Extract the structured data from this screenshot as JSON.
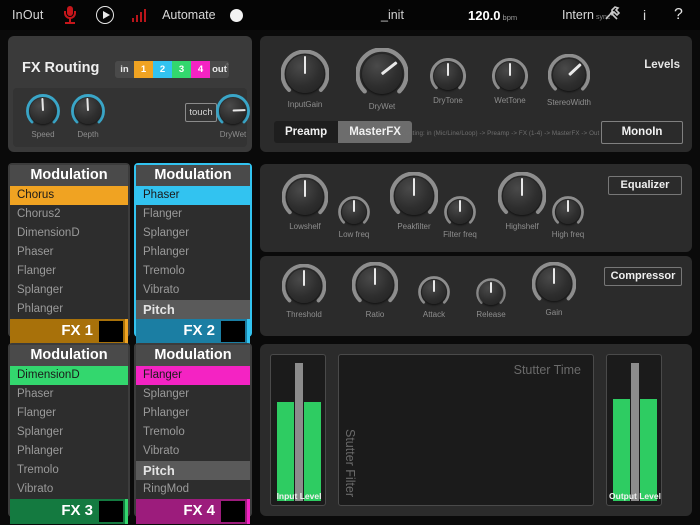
{
  "topbar": {
    "inout": "InOut",
    "mic_icon": "microphone-icon",
    "play_icon": "play-circle-icon",
    "signal_icon": "signal-bars-icon",
    "automate": "Automate",
    "record_icon": "record-dot-icon",
    "preset": "_init",
    "bpm_value": "120.0",
    "bpm_unit": "bpm",
    "sync_mode": "Intern",
    "sync_unit": "sync",
    "tools_icon": "tools-icon",
    "info_label": "i",
    "help_label": "?"
  },
  "fx_routing": {
    "title": "FX Routing",
    "chain_in": "in",
    "chain_out": "out",
    "chain_slots": [
      "1",
      "2",
      "3",
      "4"
    ],
    "arrow_up_icon": "arrow-up-icon",
    "arrow_down_icon": "arrow-down-icon",
    "touch_label": "touch",
    "knobs": [
      {
        "label": "Speed",
        "angle": -3
      },
      {
        "label": "Depth",
        "angle": -3
      },
      {
        "label": "DryWet",
        "angle": 88
      }
    ]
  },
  "levels": {
    "title": "Levels",
    "knobs": [
      {
        "label": "InputGain",
        "angle": 0
      },
      {
        "label": "DryWet",
        "angle": 52
      },
      {
        "label": "DryTone",
        "angle": 0
      },
      {
        "label": "WetTone",
        "angle": 0
      },
      {
        "label": "StereoWidth",
        "angle": 47
      }
    ],
    "segment": [
      {
        "label": "Preamp",
        "active": false
      },
      {
        "label": "MasterFX",
        "active": true
      }
    ],
    "routing_text": "Routing: in (Mic/Line/Loop) -> Preamp -> FX (1-4) -> MasterFX -> Out",
    "mono_label": "MonoIn"
  },
  "equalizer": {
    "title": "Equalizer",
    "knobs": [
      {
        "label": "Lowshelf",
        "angle": 0
      },
      {
        "label": "Low freq",
        "angle": 0
      },
      {
        "label": "Peakfilter",
        "angle": 0
      },
      {
        "label": "Filter freq",
        "angle": 0
      },
      {
        "label": "Highshelf",
        "angle": 0
      },
      {
        "label": "High freq",
        "angle": 0
      }
    ]
  },
  "compressor": {
    "title": "Compressor",
    "knobs": [
      {
        "label": "Threshold",
        "angle": 0
      },
      {
        "label": "Ratio",
        "angle": 0
      },
      {
        "label": "Attack",
        "angle": 0
      },
      {
        "label": "Release",
        "angle": 0
      },
      {
        "label": "Gain",
        "angle": 0
      }
    ]
  },
  "meters": {
    "input_label": "Input Level",
    "output_label": "Output Level",
    "input_level_pct": 72,
    "output_level_pct": 74,
    "xy_x_label": "Stutter Time",
    "xy_y_label": "Stutter Filter"
  },
  "fx_slots": [
    {
      "header": "Modulation",
      "footer": "FX 1",
      "accent": "#f0a322",
      "footer_bg": "#a8710a",
      "selected": "Chorus",
      "items": [
        {
          "label": "Chorus",
          "type": "item",
          "selected": true
        },
        {
          "label": "Chorus2",
          "type": "item",
          "selected": false
        },
        {
          "label": "DimensionD",
          "type": "item",
          "selected": false
        },
        {
          "label": "Phaser",
          "type": "item",
          "selected": false
        },
        {
          "label": "Flanger",
          "type": "item",
          "selected": false
        },
        {
          "label": "Splanger",
          "type": "item",
          "selected": false
        },
        {
          "label": "Phlanger",
          "type": "item",
          "selected": false
        }
      ]
    },
    {
      "header": "Modulation",
      "footer": "FX 2",
      "accent": "#32c3f0",
      "footer_bg": "#1b7ea3",
      "selected": "Phaser",
      "items": [
        {
          "label": "Phaser",
          "type": "item",
          "selected": true
        },
        {
          "label": "Flanger",
          "type": "item",
          "selected": false
        },
        {
          "label": "Splanger",
          "type": "item",
          "selected": false
        },
        {
          "label": "Phlanger",
          "type": "item",
          "selected": false
        },
        {
          "label": "Tremolo",
          "type": "item",
          "selected": false
        },
        {
          "label": "Vibrato",
          "type": "item",
          "selected": false
        },
        {
          "label": "Pitch",
          "type": "category",
          "selected": false
        }
      ]
    },
    {
      "header": "Modulation",
      "footer": "FX 3",
      "accent": "#33d76e",
      "footer_bg": "#147a40",
      "selected": "DimensionD",
      "items": [
        {
          "label": "DimensionD",
          "type": "item",
          "selected": true
        },
        {
          "label": "Phaser",
          "type": "item",
          "selected": false
        },
        {
          "label": "Flanger",
          "type": "item",
          "selected": false
        },
        {
          "label": "Splanger",
          "type": "item",
          "selected": false
        },
        {
          "label": "Phlanger",
          "type": "item",
          "selected": false
        },
        {
          "label": "Tremolo",
          "type": "item",
          "selected": false
        },
        {
          "label": "Vibrato",
          "type": "item",
          "selected": false
        }
      ]
    },
    {
      "header": "Modulation",
      "footer": "FX 4",
      "accent": "#f423c3",
      "footer_bg": "#9c1c7c",
      "selected": "Flanger",
      "items": [
        {
          "label": "Flanger",
          "type": "item",
          "selected": true
        },
        {
          "label": "Splanger",
          "type": "item",
          "selected": false
        },
        {
          "label": "Phlanger",
          "type": "item",
          "selected": false
        },
        {
          "label": "Tremolo",
          "type": "item",
          "selected": false
        },
        {
          "label": "Vibrato",
          "type": "item",
          "selected": false
        },
        {
          "label": "Pitch",
          "type": "category",
          "selected": false
        },
        {
          "label": "RingMod",
          "type": "item",
          "selected": false
        }
      ]
    }
  ],
  "chain_colors": [
    "#f0a322",
    "#32c3f0",
    "#33d76e",
    "#f423c3"
  ]
}
